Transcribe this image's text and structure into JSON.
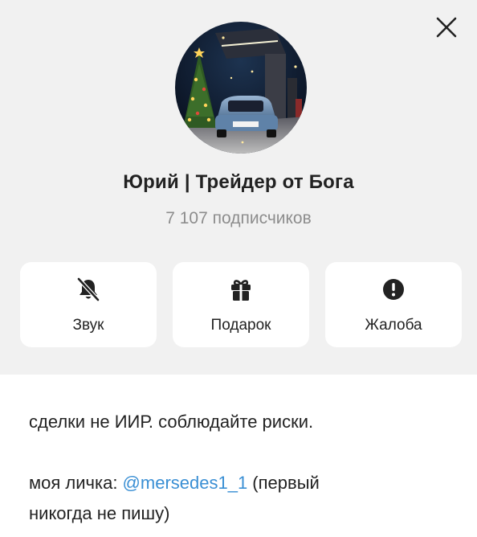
{
  "channel": {
    "name": "Юрий | Трейдер от Бога",
    "subscribers": "7 107 подписчиков"
  },
  "actions": {
    "sound": {
      "label": "Звук",
      "icon": "bell-off-icon"
    },
    "gift": {
      "label": "Подарок",
      "icon": "gift-icon"
    },
    "report": {
      "label": "Жалоба",
      "icon": "exclamation-circle-icon"
    }
  },
  "description": {
    "line1": "сделки не ИИР. соблюдайте риски.",
    "contact_prefix": "моя личка: ",
    "contact_handle": "@mersedes1_1",
    "contact_suffix": " (первый",
    "line3": "никогда не пишу)"
  },
  "colors": {
    "header_bg": "#f1f1f1",
    "link": "#3a8fd4",
    "muted": "#8d8d8d"
  }
}
